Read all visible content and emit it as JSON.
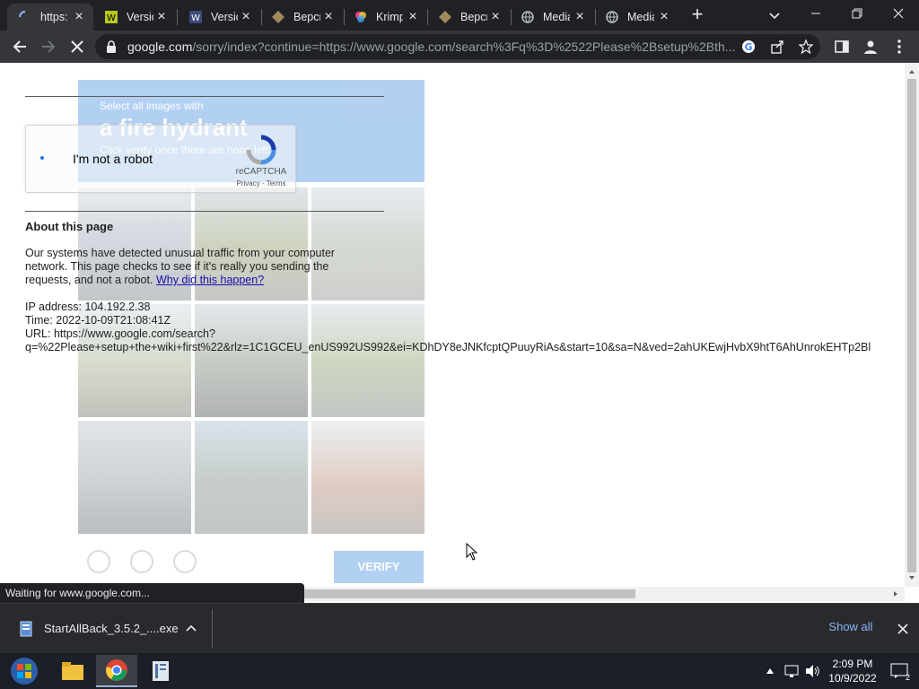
{
  "browser": {
    "tabs": [
      {
        "title": "https:",
        "active": true,
        "favicon": "loading-icon"
      },
      {
        "title": "Versio",
        "favicon": "wiki-icon"
      },
      {
        "title": "Versio",
        "favicon": "wiki-icon"
      },
      {
        "title": "Верси",
        "favicon": "game-icon"
      },
      {
        "title": "Krimpl",
        "favicon": "color-wheel-icon"
      },
      {
        "title": "Верси",
        "favicon": "game-icon"
      },
      {
        "title": "Media",
        "favicon": "globe-icon"
      },
      {
        "title": "Media",
        "favicon": "globe-icon"
      }
    ],
    "url_host": "google.com",
    "url_rest": "/sorry/index?continue=https://www.google.com/search%3Fq%3D%2522Please%2Bsetup%2Bth..."
  },
  "page": {
    "challenge": {
      "line1": "Select all images with",
      "line2": "a fire hydrant",
      "line3": "Click verify once there are none left.",
      "verify_label": "VERIFY"
    },
    "captcha": {
      "label": "I'm not a robot",
      "brand": "reCAPTCHA",
      "terms": "Privacy - Terms"
    },
    "about": {
      "title": "About this page",
      "text": "Our systems have detected unusual traffic from your computer network. This page checks to see if it's really you sending the requests, and not a robot.",
      "link": "Why did this happen?"
    },
    "ip_line": "IP address: 104.192.2.38",
    "time_line": "Time: 2022-10-09T21:08:41Z",
    "url_line1": "URL: https://www.google.com/search?",
    "url_line2": "q=%22Please+setup+the+wiki+first%22&rlz=1C1GCEU_enUS992US992&ei=KDhDY8eJNKfcptQPuuyRiAs&start=10&sa=N&ved=2ahUKEwjHvbX9htT6AhUnrokEHTp2Bl"
  },
  "status_text": "Waiting for www.google.com...",
  "downloads": {
    "file": "StartAllBack_3.5.2_....exe",
    "show_all": "Show all"
  },
  "taskbar": {
    "time": "2:09 PM",
    "date": "10/9/2022",
    "notification_count": "2"
  },
  "colors": {
    "chrome_dark": "#202124",
    "toolbar": "#35363a",
    "link": "#1a0dab",
    "recaptcha_blue": "#4a90e2"
  }
}
